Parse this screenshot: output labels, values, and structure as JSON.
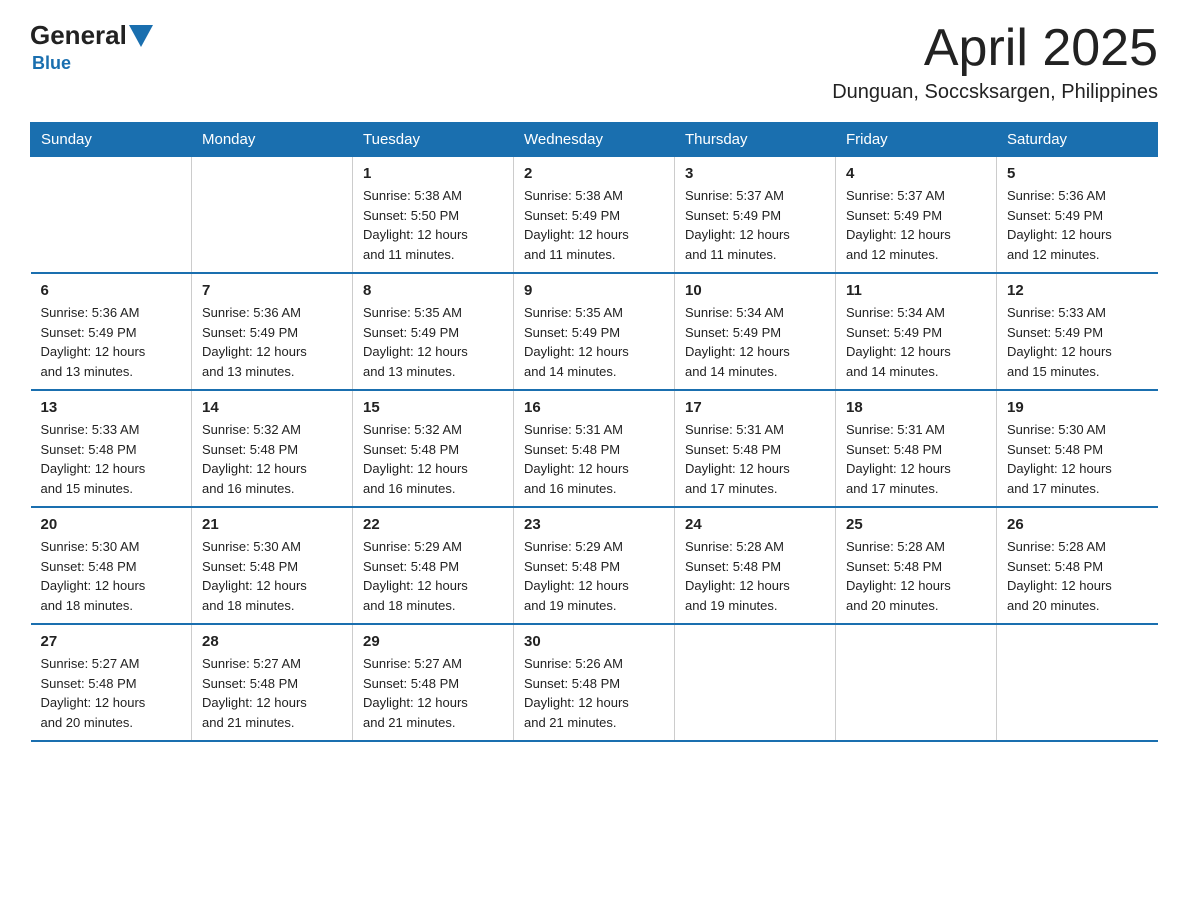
{
  "logo": {
    "general": "General",
    "blue": "Blue"
  },
  "header": {
    "title": "April 2025",
    "subtitle": "Dunguan, Soccsksargen, Philippines"
  },
  "days_of_week": [
    "Sunday",
    "Monday",
    "Tuesday",
    "Wednesday",
    "Thursday",
    "Friday",
    "Saturday"
  ],
  "weeks": [
    [
      {
        "day": "",
        "info": ""
      },
      {
        "day": "",
        "info": ""
      },
      {
        "day": "1",
        "info": "Sunrise: 5:38 AM\nSunset: 5:50 PM\nDaylight: 12 hours\nand 11 minutes."
      },
      {
        "day": "2",
        "info": "Sunrise: 5:38 AM\nSunset: 5:49 PM\nDaylight: 12 hours\nand 11 minutes."
      },
      {
        "day": "3",
        "info": "Sunrise: 5:37 AM\nSunset: 5:49 PM\nDaylight: 12 hours\nand 11 minutes."
      },
      {
        "day": "4",
        "info": "Sunrise: 5:37 AM\nSunset: 5:49 PM\nDaylight: 12 hours\nand 12 minutes."
      },
      {
        "day": "5",
        "info": "Sunrise: 5:36 AM\nSunset: 5:49 PM\nDaylight: 12 hours\nand 12 minutes."
      }
    ],
    [
      {
        "day": "6",
        "info": "Sunrise: 5:36 AM\nSunset: 5:49 PM\nDaylight: 12 hours\nand 13 minutes."
      },
      {
        "day": "7",
        "info": "Sunrise: 5:36 AM\nSunset: 5:49 PM\nDaylight: 12 hours\nand 13 minutes."
      },
      {
        "day": "8",
        "info": "Sunrise: 5:35 AM\nSunset: 5:49 PM\nDaylight: 12 hours\nand 13 minutes."
      },
      {
        "day": "9",
        "info": "Sunrise: 5:35 AM\nSunset: 5:49 PM\nDaylight: 12 hours\nand 14 minutes."
      },
      {
        "day": "10",
        "info": "Sunrise: 5:34 AM\nSunset: 5:49 PM\nDaylight: 12 hours\nand 14 minutes."
      },
      {
        "day": "11",
        "info": "Sunrise: 5:34 AM\nSunset: 5:49 PM\nDaylight: 12 hours\nand 14 minutes."
      },
      {
        "day": "12",
        "info": "Sunrise: 5:33 AM\nSunset: 5:49 PM\nDaylight: 12 hours\nand 15 minutes."
      }
    ],
    [
      {
        "day": "13",
        "info": "Sunrise: 5:33 AM\nSunset: 5:48 PM\nDaylight: 12 hours\nand 15 minutes."
      },
      {
        "day": "14",
        "info": "Sunrise: 5:32 AM\nSunset: 5:48 PM\nDaylight: 12 hours\nand 16 minutes."
      },
      {
        "day": "15",
        "info": "Sunrise: 5:32 AM\nSunset: 5:48 PM\nDaylight: 12 hours\nand 16 minutes."
      },
      {
        "day": "16",
        "info": "Sunrise: 5:31 AM\nSunset: 5:48 PM\nDaylight: 12 hours\nand 16 minutes."
      },
      {
        "day": "17",
        "info": "Sunrise: 5:31 AM\nSunset: 5:48 PM\nDaylight: 12 hours\nand 17 minutes."
      },
      {
        "day": "18",
        "info": "Sunrise: 5:31 AM\nSunset: 5:48 PM\nDaylight: 12 hours\nand 17 minutes."
      },
      {
        "day": "19",
        "info": "Sunrise: 5:30 AM\nSunset: 5:48 PM\nDaylight: 12 hours\nand 17 minutes."
      }
    ],
    [
      {
        "day": "20",
        "info": "Sunrise: 5:30 AM\nSunset: 5:48 PM\nDaylight: 12 hours\nand 18 minutes."
      },
      {
        "day": "21",
        "info": "Sunrise: 5:30 AM\nSunset: 5:48 PM\nDaylight: 12 hours\nand 18 minutes."
      },
      {
        "day": "22",
        "info": "Sunrise: 5:29 AM\nSunset: 5:48 PM\nDaylight: 12 hours\nand 18 minutes."
      },
      {
        "day": "23",
        "info": "Sunrise: 5:29 AM\nSunset: 5:48 PM\nDaylight: 12 hours\nand 19 minutes."
      },
      {
        "day": "24",
        "info": "Sunrise: 5:28 AM\nSunset: 5:48 PM\nDaylight: 12 hours\nand 19 minutes."
      },
      {
        "day": "25",
        "info": "Sunrise: 5:28 AM\nSunset: 5:48 PM\nDaylight: 12 hours\nand 20 minutes."
      },
      {
        "day": "26",
        "info": "Sunrise: 5:28 AM\nSunset: 5:48 PM\nDaylight: 12 hours\nand 20 minutes."
      }
    ],
    [
      {
        "day": "27",
        "info": "Sunrise: 5:27 AM\nSunset: 5:48 PM\nDaylight: 12 hours\nand 20 minutes."
      },
      {
        "day": "28",
        "info": "Sunrise: 5:27 AM\nSunset: 5:48 PM\nDaylight: 12 hours\nand 21 minutes."
      },
      {
        "day": "29",
        "info": "Sunrise: 5:27 AM\nSunset: 5:48 PM\nDaylight: 12 hours\nand 21 minutes."
      },
      {
        "day": "30",
        "info": "Sunrise: 5:26 AM\nSunset: 5:48 PM\nDaylight: 12 hours\nand 21 minutes."
      },
      {
        "day": "",
        "info": ""
      },
      {
        "day": "",
        "info": ""
      },
      {
        "day": "",
        "info": ""
      }
    ]
  ]
}
